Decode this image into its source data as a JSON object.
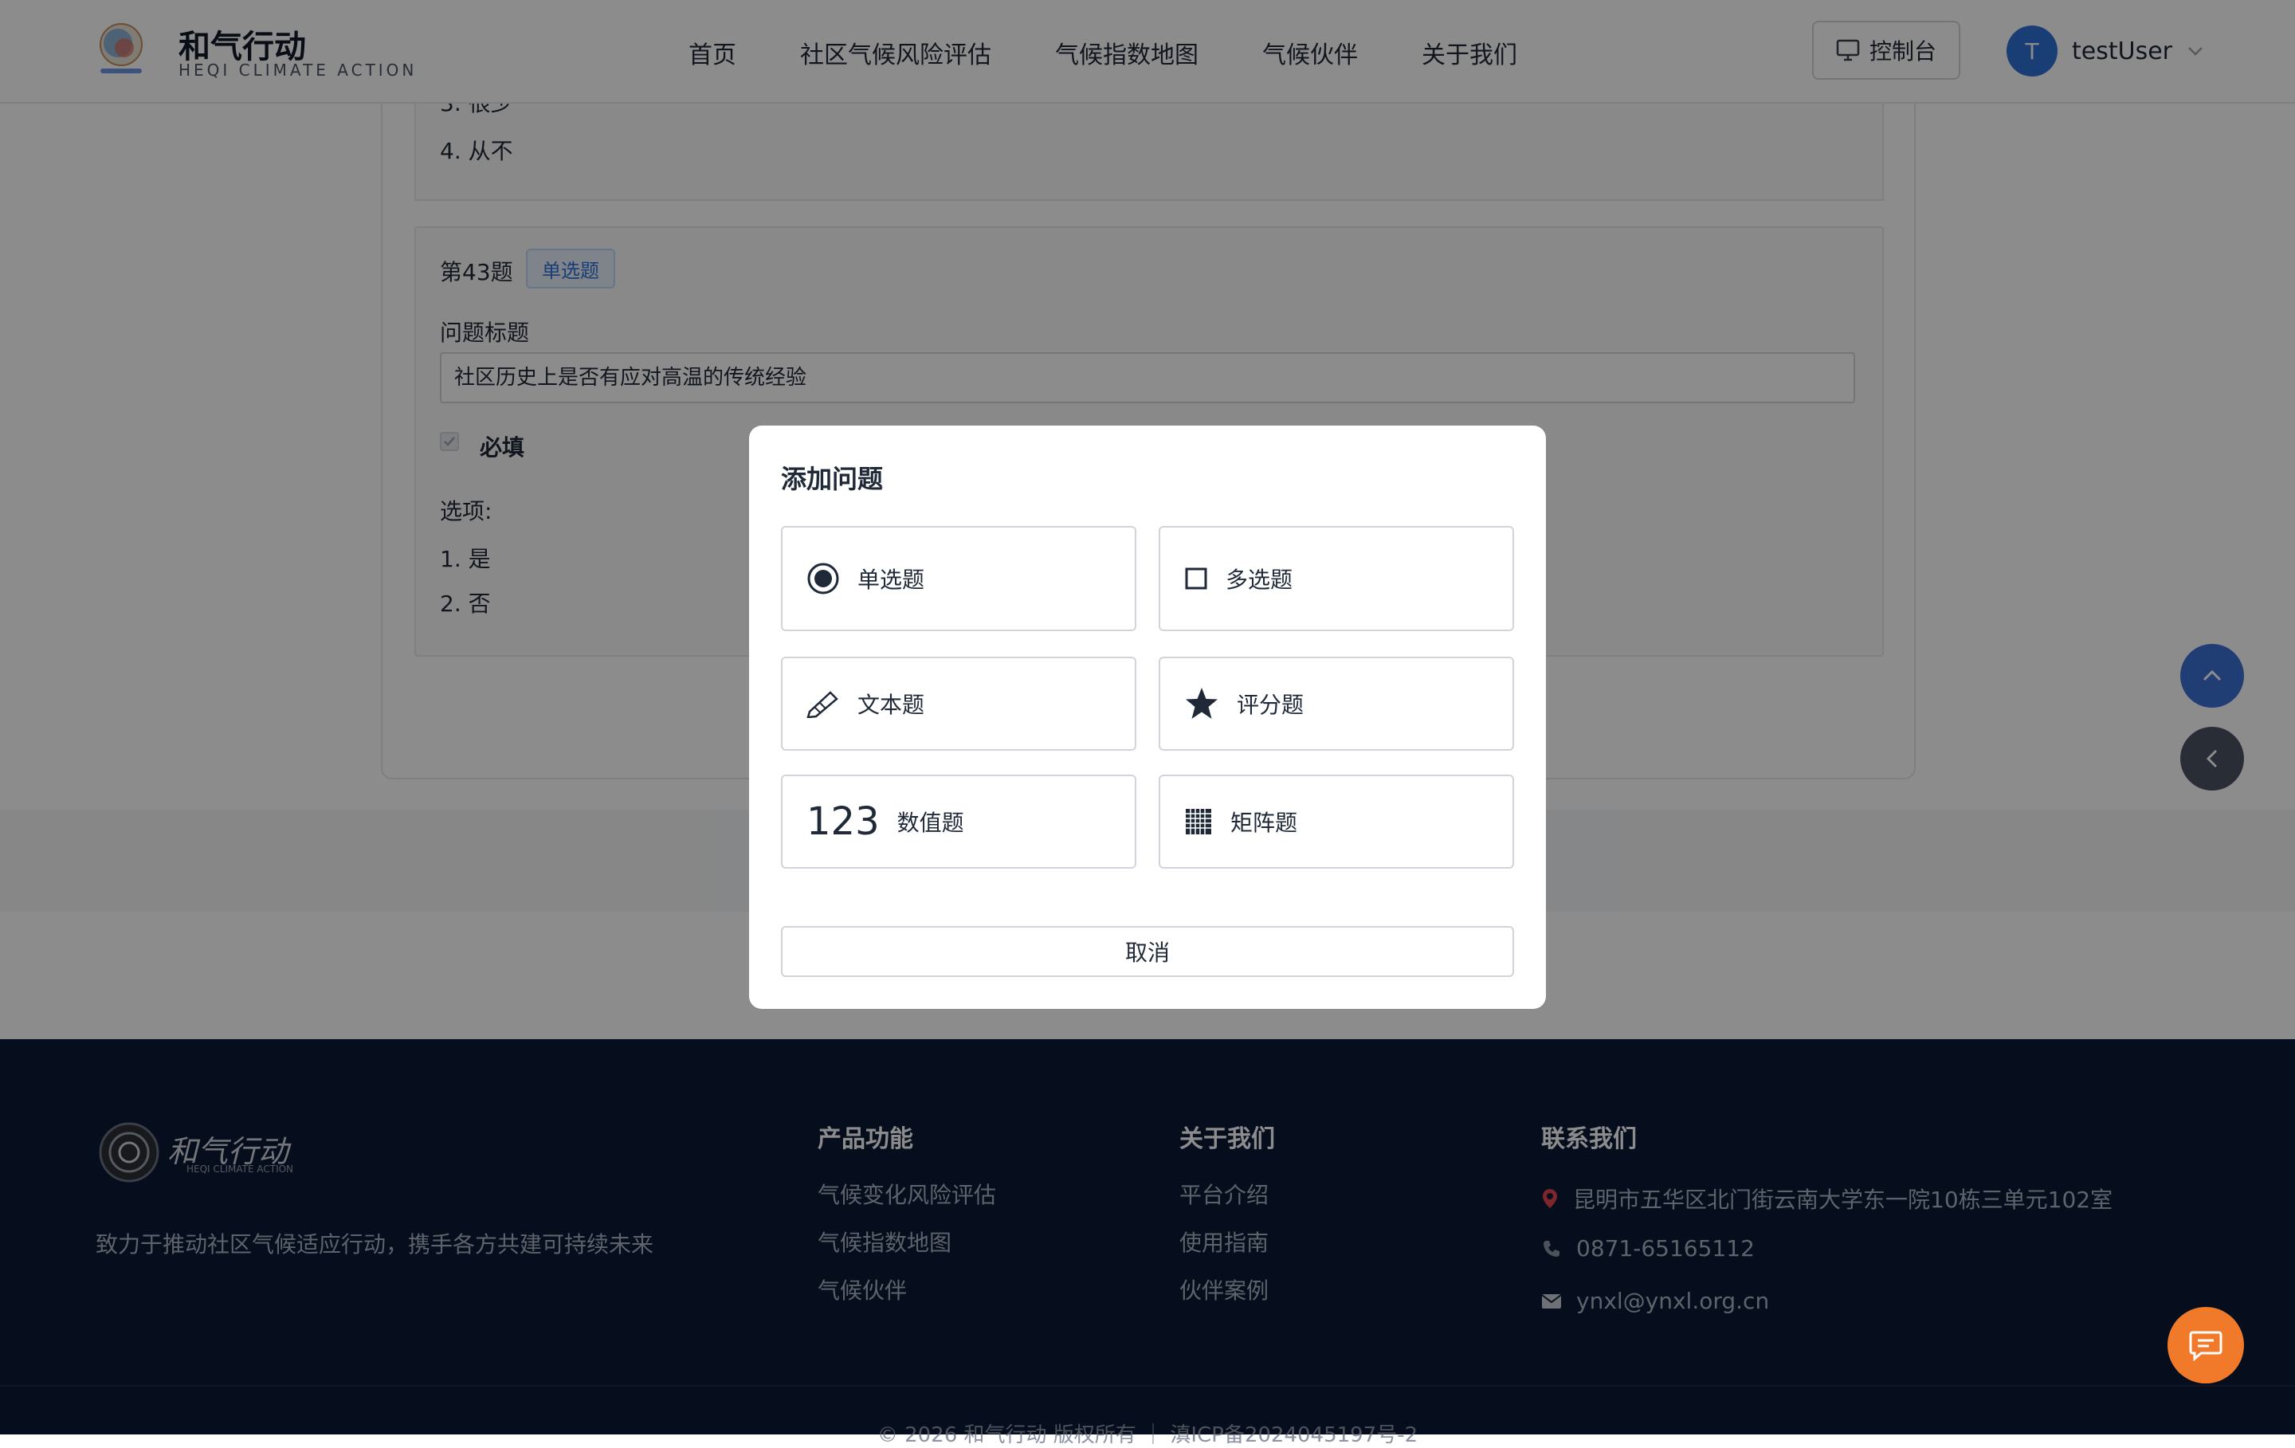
{
  "header": {
    "brand_title": "和气行动",
    "brand_subtitle": "HEQI CLIMATE ACTION",
    "nav": [
      "首页",
      "社区气候风险评估",
      "气候指数地图",
      "气候伙伴",
      "关于我们"
    ],
    "console_label": "控制台",
    "avatar_letter": "T",
    "username": "testUser"
  },
  "main": {
    "prev_question": {
      "options": [
        "3. 很少",
        "4. 从不"
      ]
    },
    "question": {
      "number": "第43题",
      "type_tag": "单选题",
      "title_label": "问题标题",
      "title_value": "社区历史上是否有应对高温的传统经验",
      "required_label": "必填",
      "required_checked": true,
      "options_label": "选项:",
      "options": [
        "1. 是",
        "2. 否"
      ]
    }
  },
  "modal": {
    "title": "添加问题",
    "options": [
      {
        "label": "单选题",
        "icon": "radio-icon"
      },
      {
        "label": "多选题",
        "icon": "checkbox-icon"
      },
      {
        "label": "文本题",
        "icon": "pencil-icon"
      },
      {
        "label": "评分题",
        "icon": "star-icon"
      },
      {
        "label": "数值题",
        "icon": "number-icon",
        "icon_text": "123"
      },
      {
        "label": "矩阵题",
        "icon": "grid-icon"
      }
    ],
    "cancel_label": "取消"
  },
  "footer": {
    "logo_text": "和气行动",
    "logo_sub": "HEQI CLIMATE ACTION",
    "tagline": "致力于推动社区气候适应行动，携手各方共建可持续未来",
    "columns": [
      {
        "heading": "产品功能",
        "links": [
          "气候变化风险评估",
          "气候指数地图",
          "气候伙伴"
        ]
      },
      {
        "heading": "关于我们",
        "links": [
          "平台介绍",
          "使用指南",
          "伙伴案例"
        ]
      }
    ],
    "contact": {
      "heading": "联系我们",
      "address": "昆明市五华区北门街云南大学东一院10栋三单元102室",
      "phone": "0871-65165112",
      "email": "ynxl@ynxl.org.cn"
    },
    "copyright": "© 2026 和气行动 版权所有 ｜ 滇ICP备2024045197号-2"
  },
  "colors": {
    "primary": "#2f6fd6",
    "footer_bg": "#0b1a36",
    "chat_fab": "#f07a2a"
  }
}
